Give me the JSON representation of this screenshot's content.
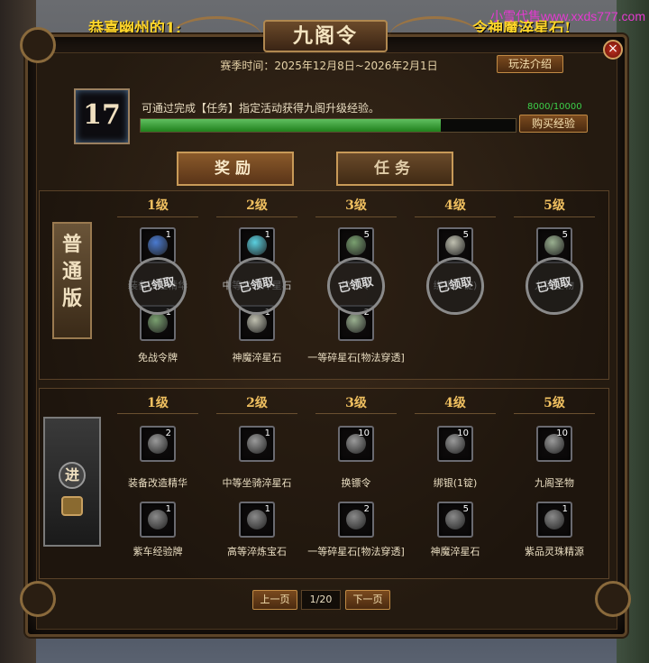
{
  "marquee": {
    "left": "恭喜幽州的1:",
    "right": "令神魔淬星石!"
  },
  "watermark": "小雪代售www.xxds777.com",
  "window": {
    "title": "九阁令",
    "close": "×"
  },
  "season": {
    "text": "赛季时间：2025年12月8日~2026年2月1日",
    "guide_button": "玩法介绍"
  },
  "level": {
    "value": "17",
    "hint": "可通过完成【任务】指定活动获得九阁升级经验。",
    "exp_text": "8000/10000",
    "exp_fraction": 0.8,
    "buy_button": "购买经验"
  },
  "tabs": [
    {
      "label": "奖励"
    },
    {
      "label": "任务"
    }
  ],
  "normal": {
    "tag": "普通版",
    "stamp": "已领取",
    "columns": [
      {
        "level": "1级",
        "top_count": "1",
        "bottom_name": "免战令牌",
        "top_label": "装备改造精华",
        "bottom_count": "1"
      },
      {
        "level": "2级",
        "top_count": "1",
        "bottom_name": "神魔淬星石",
        "top_label": "中等坐骑淬星石",
        "bottom_count": "1"
      },
      {
        "level": "3级",
        "top_count": "5",
        "bottom_name": "一等碎星石[物法穿透]",
        "top_label": "换镖令",
        "bottom_count": "2"
      },
      {
        "level": "4级",
        "top_count": "5",
        "top_label": "绑银(1锭)",
        "bottom_name": "",
        "bottom_count": ""
      },
      {
        "level": "5级",
        "top_count": "5",
        "top_label": "九阁圣物",
        "bottom_name": "",
        "bottom_count": ""
      }
    ]
  },
  "advanced": {
    "tag": "进",
    "columns": [
      {
        "level": "1级",
        "top_count": "2",
        "top_name": "装备改造精华",
        "bottom_count": "1",
        "bottom_name": "紫车经验牌"
      },
      {
        "level": "2级",
        "top_count": "1",
        "top_name": "中等坐骑淬星石",
        "bottom_count": "1",
        "bottom_name": "高等淬炼宝石"
      },
      {
        "level": "3级",
        "top_count": "10",
        "top_name": "换镖令",
        "bottom_count": "2",
        "bottom_name": "一等碎星石[物法穿透]"
      },
      {
        "level": "4级",
        "top_count": "10",
        "top_name": "绑银(1锭)",
        "bottom_count": "5",
        "bottom_name": "神魔淬星石"
      },
      {
        "level": "5级",
        "top_count": "10",
        "top_name": "九阁圣物",
        "bottom_count": "1",
        "bottom_name": "紫品灵珠精源"
      }
    ]
  },
  "pager": {
    "prev": "上一页",
    "page": "1/20",
    "next": "下一页"
  },
  "colors": {
    "accent": "#f0c060",
    "exp": "#3cd04a",
    "panel": "#241a10"
  }
}
